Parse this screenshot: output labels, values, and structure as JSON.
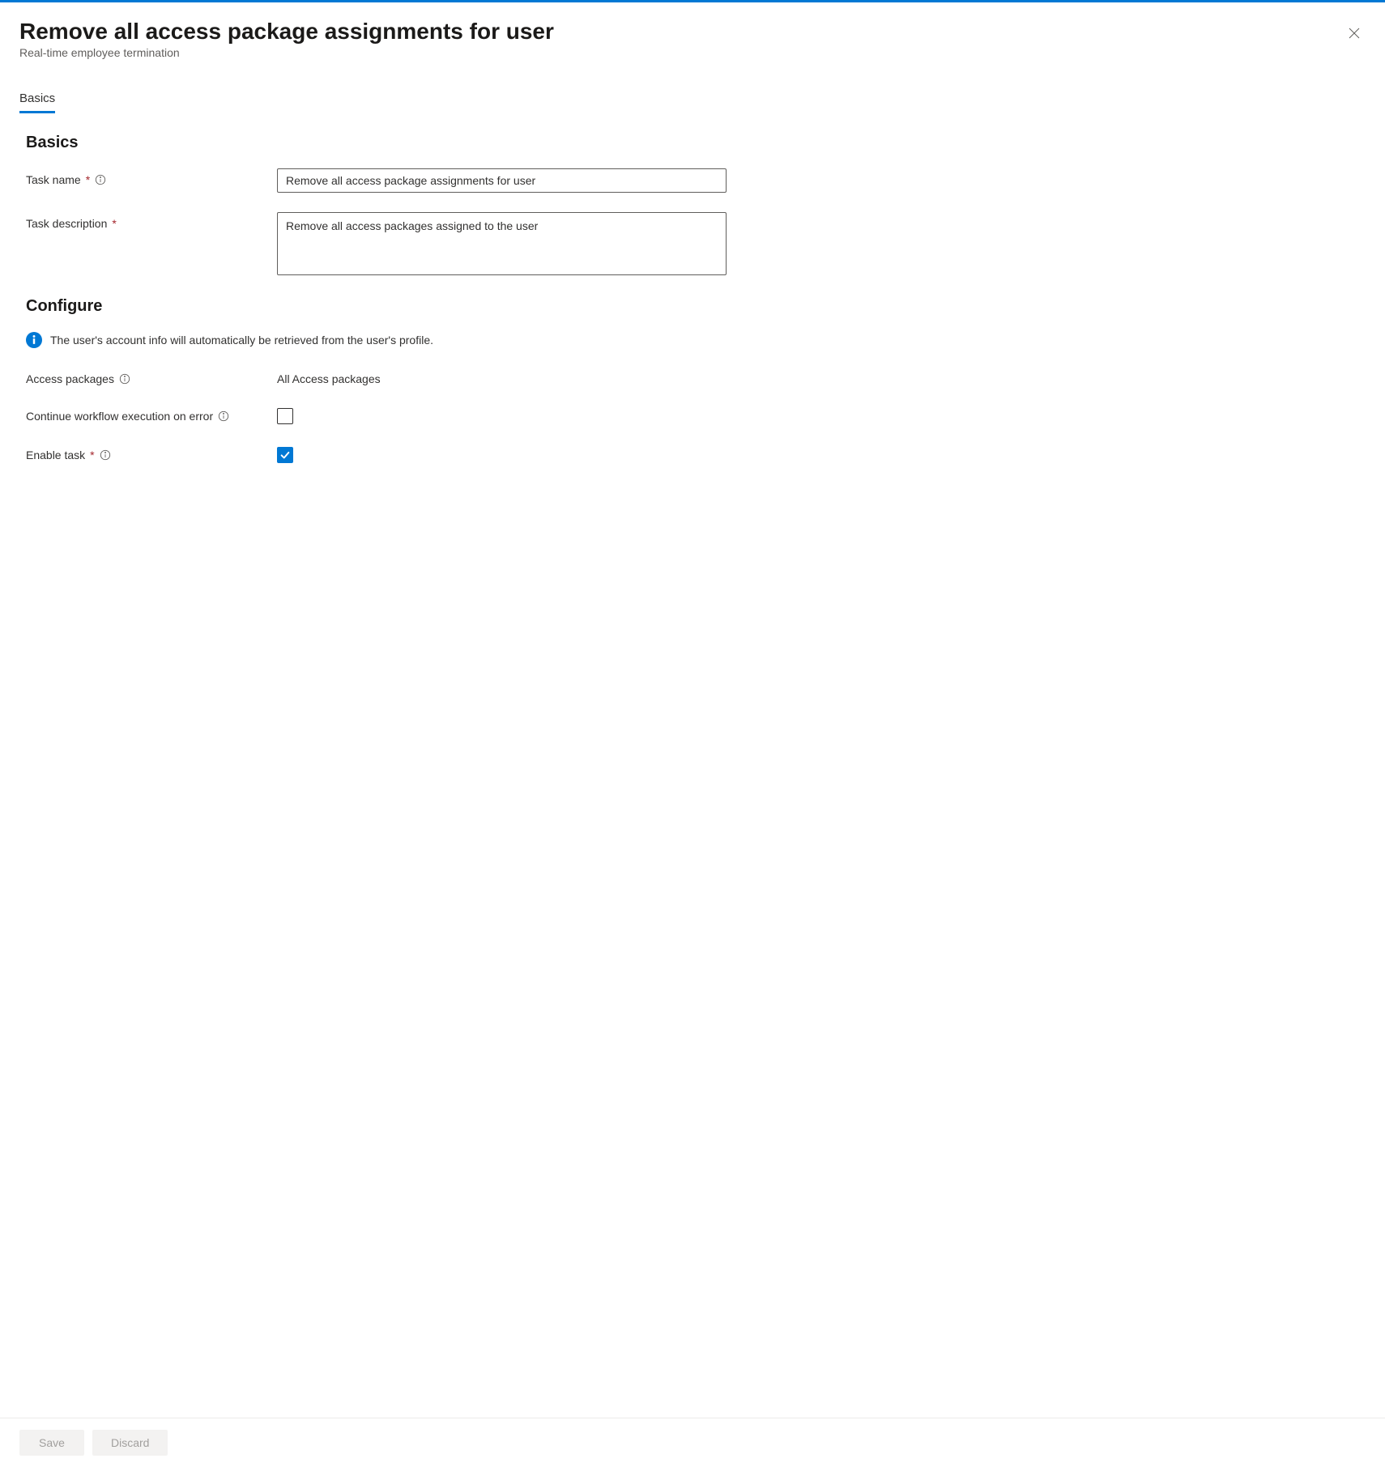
{
  "header": {
    "title": "Remove all access package assignments for user",
    "subtitle": "Real-time employee termination"
  },
  "tabs": {
    "basics": "Basics"
  },
  "sections": {
    "basics": "Basics",
    "configure": "Configure"
  },
  "form": {
    "task_name_label": "Task name",
    "task_name_value": "Remove all access package assignments for user",
    "task_description_label": "Task description",
    "task_description_value": "Remove all access packages assigned to the user",
    "info_message": "The user's account info will automatically be retrieved from the user's profile.",
    "access_packages_label": "Access packages",
    "access_packages_value": "All Access packages",
    "continue_on_error_label": "Continue workflow execution on error",
    "continue_on_error_checked": false,
    "enable_task_label": "Enable task",
    "enable_task_checked": true
  },
  "footer": {
    "save_label": "Save",
    "discard_label": "Discard"
  }
}
